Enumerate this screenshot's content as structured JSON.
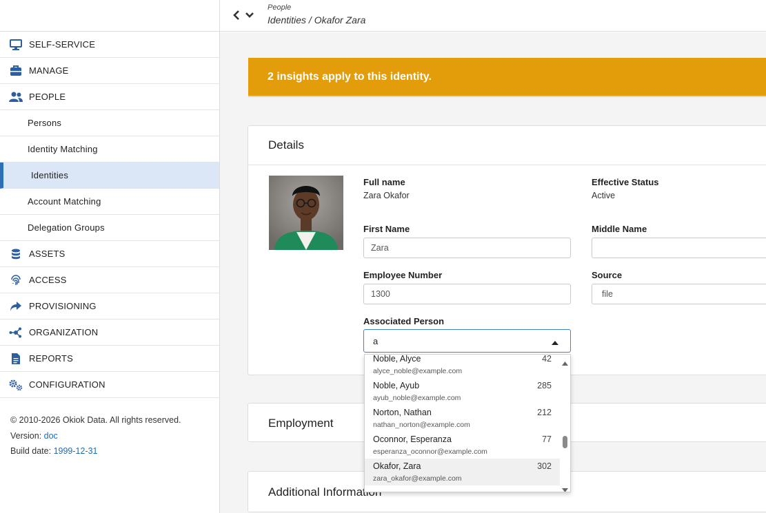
{
  "sidebar": {
    "items": [
      {
        "label": "SELF-SERVICE",
        "icon": "monitor-icon"
      },
      {
        "label": "MANAGE",
        "icon": "toolbox-icon"
      },
      {
        "label": "PEOPLE",
        "icon": "users-icon"
      },
      {
        "label": "Persons"
      },
      {
        "label": "Identity Matching"
      },
      {
        "label": "Identities"
      },
      {
        "label": "Account Matching"
      },
      {
        "label": "Delegation Groups"
      },
      {
        "label": "ASSETS",
        "icon": "database-icon"
      },
      {
        "label": "ACCESS",
        "icon": "fingerprint-icon"
      },
      {
        "label": "PROVISIONING",
        "icon": "share-icon"
      },
      {
        "label": "ORGANIZATION",
        "icon": "network-icon"
      },
      {
        "label": "REPORTS",
        "icon": "file-icon"
      },
      {
        "label": "CONFIGURATION",
        "icon": "cogs-icon"
      }
    ],
    "footer": {
      "copyright": "© 2010-2026 Okiok Data. All rights reserved.",
      "version_label": "Version:",
      "version_value": "doc",
      "build_label": "Build date:",
      "build_value": "1999-12-31"
    }
  },
  "header": {
    "breadcrumb_parent": "People",
    "breadcrumb_current": "Identities / Okafor Zara"
  },
  "banner": {
    "text": "2 insights apply to this identity.",
    "color": "#e39c0a"
  },
  "details": {
    "title": "Details",
    "full_name_label": "Full name",
    "full_name_value": "Zara Okafor",
    "effective_status_label": "Effective Status",
    "effective_status_value": "Active",
    "first_name_label": "First Name",
    "first_name_value": "Zara",
    "middle_name_label": "Middle Name",
    "middle_name_value": "",
    "employee_number_label": "Employee Number",
    "employee_number_value": "1300",
    "source_label": "Source",
    "source_value": "file",
    "associated_person_label": "Associated Person",
    "associated_person_query": "a"
  },
  "dropdown": {
    "options": [
      {
        "name": "Noble, Alyce",
        "email": "alyce_noble@example.com",
        "number": "42"
      },
      {
        "name": "Noble, Ayub",
        "email": "ayub_noble@example.com",
        "number": "285"
      },
      {
        "name": "Norton, Nathan",
        "email": "nathan_norton@example.com",
        "number": "212"
      },
      {
        "name": "Oconnor, Esperanza",
        "email": "esperanza_oconnor@example.com",
        "number": "77"
      },
      {
        "name": "Okafor, Zara",
        "email": "zara_okafor@example.com",
        "number": "302"
      }
    ],
    "selected_index": 4
  },
  "sections": {
    "employment": "Employment",
    "additional": "Additional Information"
  },
  "colors": {
    "accent": "#2f6fb8",
    "active_bg": "#dbe7f6",
    "link": "#1e6bb8"
  }
}
